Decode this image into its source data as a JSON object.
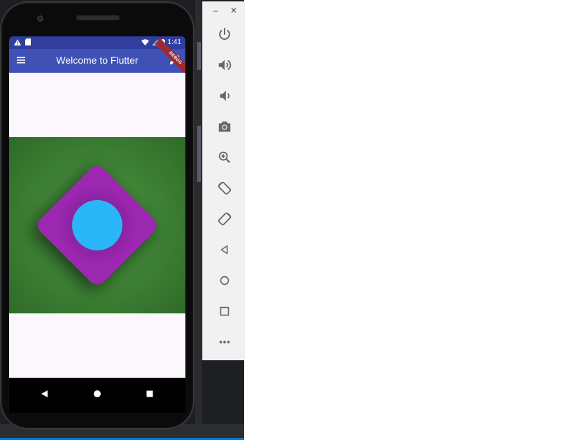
{
  "app": {
    "title": "Welcome to Flutter",
    "debug_banner": "DEBUG"
  },
  "statusbar": {
    "time": "1:41",
    "left_icons": [
      "warning-icon",
      "sd-card-icon"
    ],
    "right_icons": [
      "wifi-icon",
      "signal-icon",
      "battery-icon"
    ]
  },
  "appbar": {
    "leading_icon": "menu-icon",
    "action_icon": "edit-icon"
  },
  "content": {
    "background_color": "#fcf7fd",
    "square_color": "#43883a",
    "diamond_color": "#9c27b0",
    "circle_color": "#29b6f6"
  },
  "navbar": {
    "buttons": [
      "back-icon",
      "home-icon",
      "recents-icon"
    ]
  },
  "emulator_toolbar": {
    "window_controls": {
      "minimize": "–",
      "close": "✕"
    },
    "tools": [
      {
        "name": "power-icon",
        "label": "Power"
      },
      {
        "name": "volume-up-icon",
        "label": "Volume up"
      },
      {
        "name": "volume-down-icon",
        "label": "Volume down"
      },
      {
        "name": "camera-icon",
        "label": "Take screenshot"
      },
      {
        "name": "zoom-icon",
        "label": "Zoom"
      },
      {
        "name": "rotate-left-icon",
        "label": "Rotate left"
      },
      {
        "name": "rotate-right-icon",
        "label": "Rotate right"
      },
      {
        "name": "back-icon",
        "label": "Back"
      },
      {
        "name": "home-icon",
        "label": "Home"
      },
      {
        "name": "overview-icon",
        "label": "Overview"
      },
      {
        "name": "more-icon",
        "label": "More"
      }
    ]
  }
}
